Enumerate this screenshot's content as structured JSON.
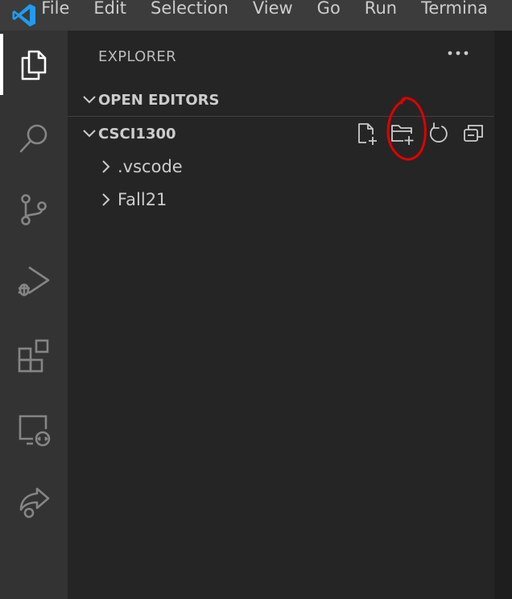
{
  "menubar": {
    "items": [
      "File",
      "Edit",
      "Selection",
      "View",
      "Go",
      "Run",
      "Termina"
    ]
  },
  "activitybar": {
    "icons": [
      "explorer-icon",
      "search-icon",
      "source-control-icon",
      "run-debug-icon",
      "extensions-icon",
      "remote-explorer-icon",
      "live-share-icon"
    ],
    "active": "explorer-icon"
  },
  "sidebar": {
    "title": "EXPLORER",
    "sections": {
      "open_editors": {
        "label": "OPEN EDITORS",
        "expanded": false
      },
      "workspace": {
        "label": "CSCI1300",
        "expanded": true,
        "actions": [
          "new-file-icon",
          "new-folder-icon",
          "refresh-icon",
          "collapse-all-icon"
        ]
      }
    },
    "tree": [
      {
        "label": ".vscode",
        "expanded": false
      },
      {
        "label": "Fall21",
        "expanded": false
      }
    ]
  },
  "colors": {
    "menubar_bg": "#3c3c3c",
    "activitybar_bg": "#333333",
    "sidebar_bg": "#252526",
    "text": "#cccccc",
    "annotation": "#e00000"
  }
}
